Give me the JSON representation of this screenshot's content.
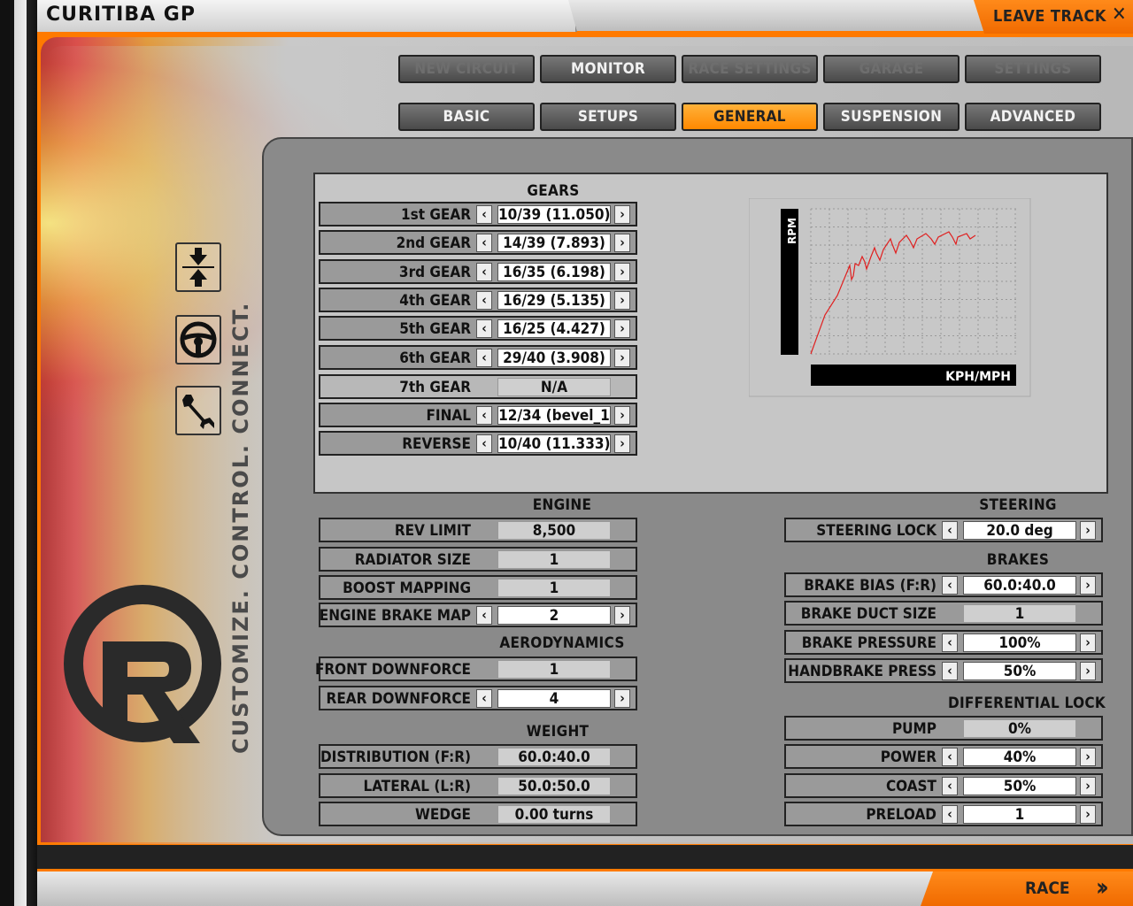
{
  "header": {
    "title": "CURITIBA GP",
    "leave_label": "LEAVE TRACK",
    "leave_icon": "close-icon"
  },
  "footer": {
    "race_label": "RACE",
    "race_icon": "double-chevron-right-icon"
  },
  "brand": {
    "slogan": "CUSTOMIZE. CONTROL. CONNECT.",
    "accent": "#ff7a00"
  },
  "nav_top": [
    {
      "label": "NEW CIRCUIT",
      "enabled": false
    },
    {
      "label": "MONITOR",
      "enabled": true
    },
    {
      "label": "RACE SETTINGS",
      "enabled": false
    },
    {
      "label": "GARAGE",
      "enabled": false
    },
    {
      "label": "SETTINGS",
      "enabled": false
    }
  ],
  "nav_sub": [
    {
      "label": "BASIC",
      "active": false
    },
    {
      "label": "SETUPS",
      "active": false
    },
    {
      "label": "GENERAL",
      "active": true
    },
    {
      "label": "SUSPENSION",
      "active": false
    },
    {
      "label": "ADVANCED",
      "active": false
    }
  ],
  "gears": {
    "title": "GEARS",
    "rows": [
      {
        "label": "1st GEAR",
        "value": "10/39 (11.050)",
        "editable": true
      },
      {
        "label": "2nd GEAR",
        "value": "14/39 (7.893)",
        "editable": true
      },
      {
        "label": "3rd GEAR",
        "value": "16/35 (6.198)",
        "editable": true
      },
      {
        "label": "4th GEAR",
        "value": "16/29 (5.135)",
        "editable": true
      },
      {
        "label": "5th GEAR",
        "value": "16/25 (4.427)",
        "editable": true
      },
      {
        "label": "6th GEAR",
        "value": "29/40 (3.908)",
        "editable": true
      },
      {
        "label": "7th GEAR",
        "value": "N/A",
        "editable": false
      },
      {
        "label": "FINAL",
        "value": "12/34 (bevel_1",
        "editable": true
      },
      {
        "label": "REVERSE",
        "value": "10/40 (11.333)",
        "editable": true
      }
    ]
  },
  "gear_chart": {
    "y_label": "RPM",
    "x_label": "KPH/MPH",
    "line_color": "#e02020"
  },
  "engine": {
    "title": "ENGINE",
    "rows": [
      {
        "label": "REV LIMIT",
        "value": "8,500",
        "editable": false
      },
      {
        "label": "RADIATOR SIZE",
        "value": "1",
        "editable": false
      },
      {
        "label": "BOOST MAPPING",
        "value": "1",
        "editable": false
      },
      {
        "label": "ENGINE BRAKE MAP",
        "value": "2",
        "editable": true
      }
    ]
  },
  "aero": {
    "title": "AERODYNAMICS",
    "rows": [
      {
        "label": "FRONT DOWNFORCE",
        "value": "1",
        "editable": false
      },
      {
        "label": "REAR DOWNFORCE",
        "value": "4",
        "editable": true
      }
    ]
  },
  "weight": {
    "title": "WEIGHT",
    "rows": [
      {
        "label": "DISTRIBUTION (F:R)",
        "value": "60.0:40.0",
        "editable": false
      },
      {
        "label": "LATERAL (L:R)",
        "value": "50.0:50.0",
        "editable": false
      },
      {
        "label": "WEDGE",
        "value": "0.00 turns",
        "editable": false
      }
    ]
  },
  "steering": {
    "title": "STEERING",
    "rows": [
      {
        "label": "STEERING LOCK",
        "value": "20.0 deg",
        "editable": true
      }
    ]
  },
  "brakes": {
    "title": "BRAKES",
    "rows": [
      {
        "label": "BRAKE BIAS (F:R)",
        "value": "60.0:40.0",
        "editable": true
      },
      {
        "label": "BRAKE DUCT SIZE",
        "value": "1",
        "editable": false
      },
      {
        "label": "BRAKE PRESSURE",
        "value": "100%",
        "editable": true
      },
      {
        "label": "HANDBRAKE PRESS",
        "value": "50%",
        "editable": true
      }
    ]
  },
  "diff": {
    "title": "DIFFERENTIAL LOCK",
    "rows": [
      {
        "label": "PUMP",
        "value": "0%",
        "editable": false
      },
      {
        "label": "POWER",
        "value": "40%",
        "editable": true
      },
      {
        "label": "COAST",
        "value": "50%",
        "editable": true
      },
      {
        "label": "PRELOAD",
        "value": "1",
        "editable": true
      }
    ]
  }
}
